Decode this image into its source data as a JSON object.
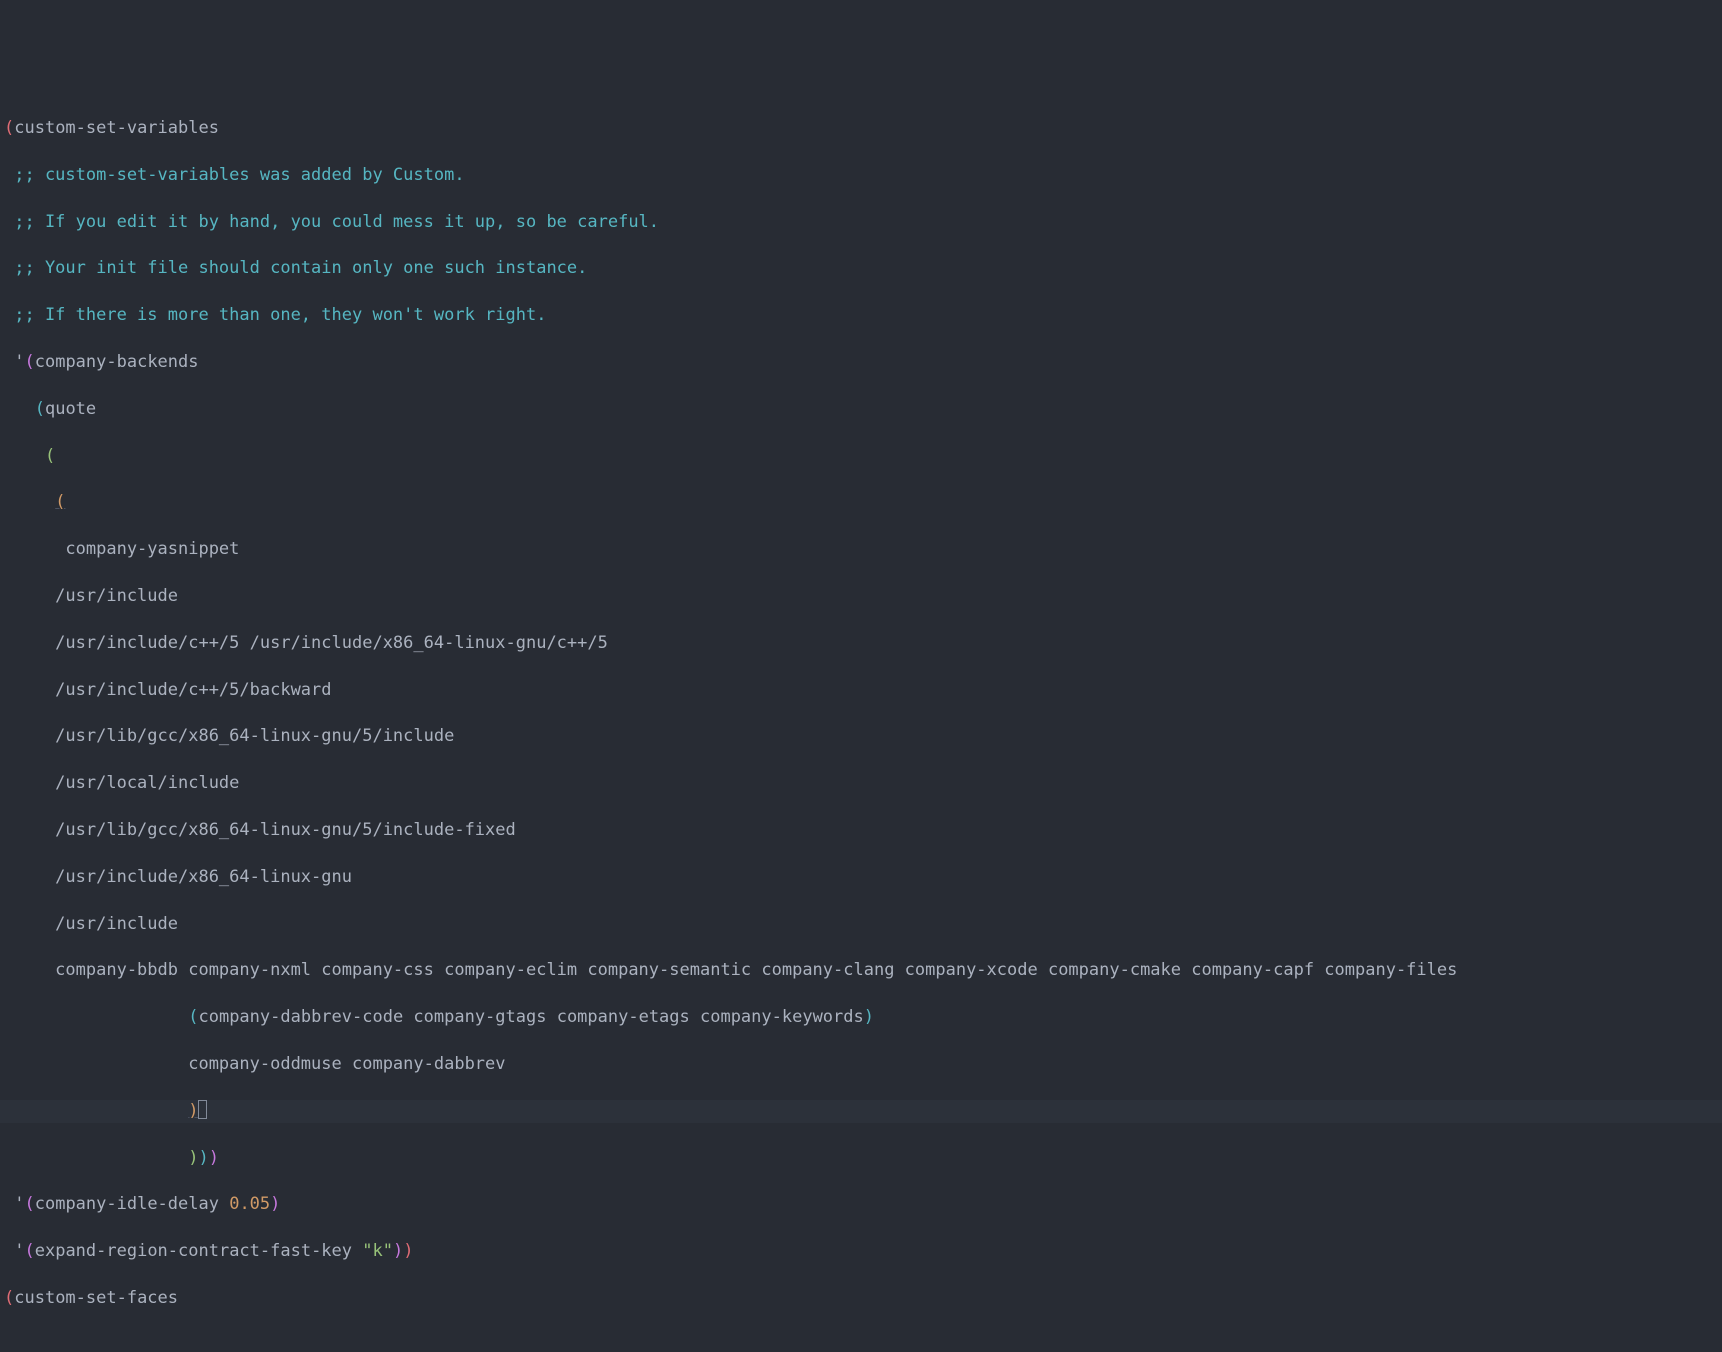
{
  "lines": {
    "l0": {
      "p1": "(",
      "t1": "custom-set-variables"
    },
    "l1": {
      "c": " ;; custom-set-variables was added by Custom."
    },
    "l2": {
      "c": " ;; If you edit it by hand, you could mess it up, so be careful."
    },
    "l3": {
      "c": " ;; Your init file should contain only one such instance."
    },
    "l4": {
      "c": " ;; If there is more than one, they won't work right."
    },
    "l5": {
      "q": " '",
      "p": "(",
      "t": "company-backends"
    },
    "l6": {
      "sp": "   ",
      "p": "(",
      "t": "quote"
    },
    "l7": {
      "sp": "    ",
      "p": "("
    },
    "l8": {
      "sp": "     ",
      "p": "("
    },
    "l9": {
      "t": "      company-yasnippet"
    },
    "l10": {
      "t": "     /usr/include"
    },
    "l11": {
      "t": "     /usr/include/c++/5 /usr/include/x86_64-linux-gnu/c++/5"
    },
    "l12": {
      "t": "     /usr/include/c++/5/backward"
    },
    "l13": {
      "t": "     /usr/lib/gcc/x86_64-linux-gnu/5/include"
    },
    "l14": {
      "t": "     /usr/local/include"
    },
    "l15": {
      "t": "     /usr/lib/gcc/x86_64-linux-gnu/5/include-fixed"
    },
    "l16": {
      "t": "     /usr/include/x86_64-linux-gnu"
    },
    "l17": {
      "t": "     /usr/include"
    },
    "l18": {
      "t": "     company-bbdb company-nxml company-css company-eclim company-semantic company-clang company-xcode company-cmake company-capf company-files"
    },
    "l19": {
      "sp": "                  ",
      "p1": "(",
      "t": "company-dabbrev-code company-gtags company-etags company-keywords",
      "p2": ")"
    },
    "l20": {
      "t": "                  company-oddmuse company-dabbrev"
    },
    "l21": {
      "sp": "                  ",
      "p": ")"
    },
    "l22": {
      "sp": "                  ",
      "p1": ")",
      "p2": ")",
      "p3": ")"
    },
    "l23": {
      "q": " '",
      "p1": "(",
      "t1": "company-idle-delay ",
      "n": "0.05",
      "p2": ")"
    },
    "l24": {
      "q": " '",
      "p1": "(",
      "t1": "expand-region-contract-fast-key ",
      "s": "\"k\"",
      "p2": ")",
      "p3": ")"
    },
    "l25": {
      "p": "(",
      "t": "custom-set-faces"
    }
  }
}
